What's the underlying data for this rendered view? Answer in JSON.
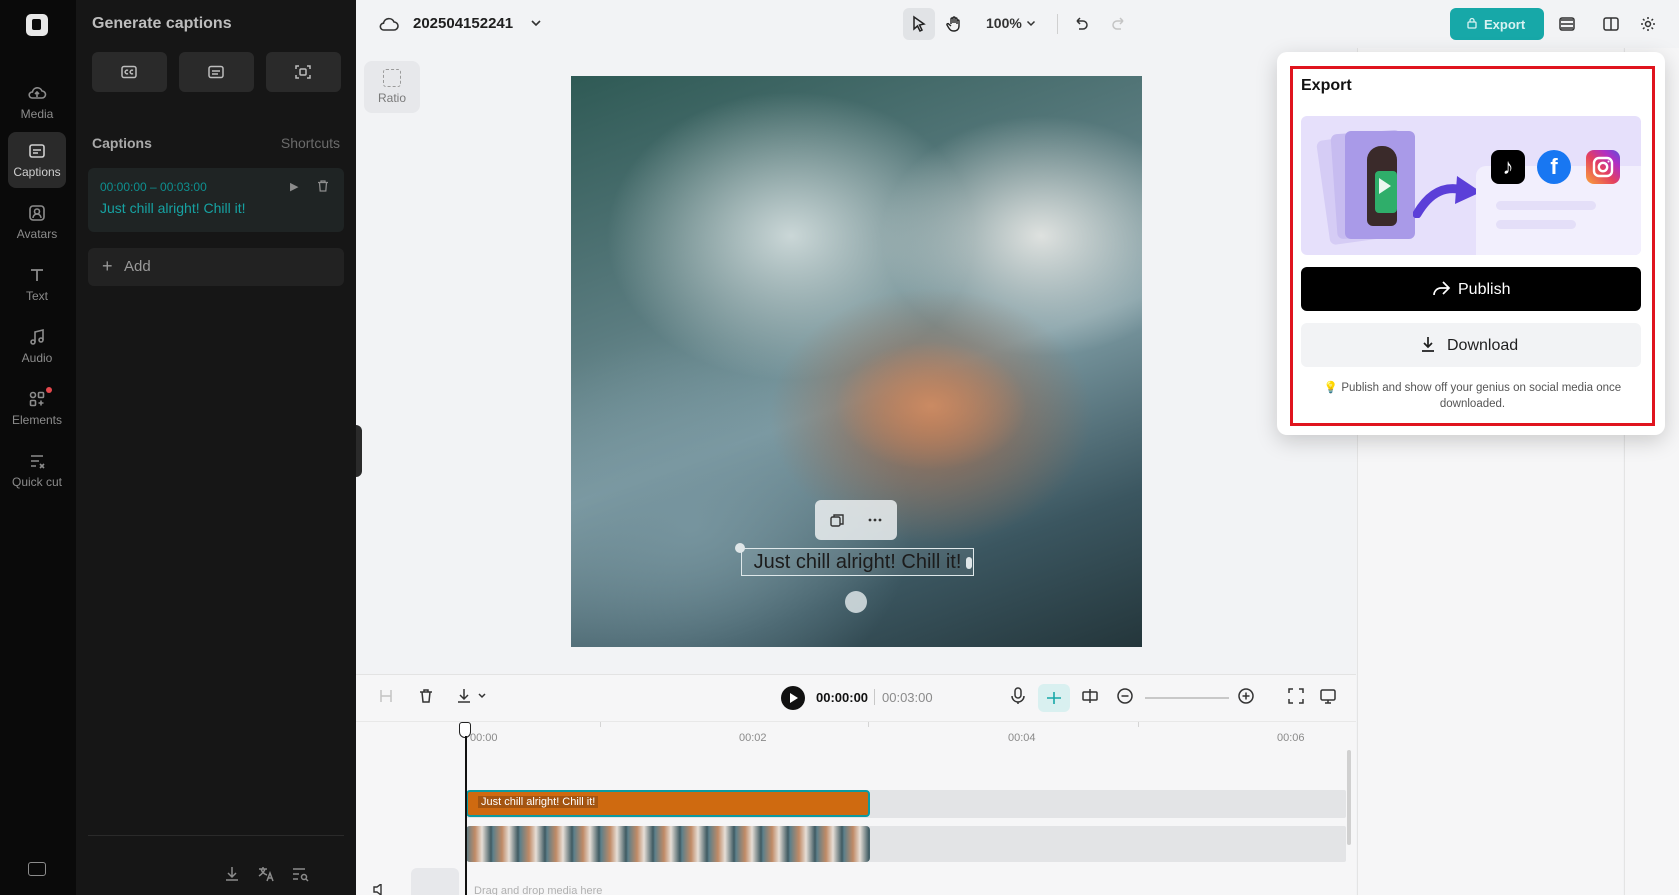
{
  "rail": {
    "items": [
      {
        "label": "Media",
        "icon": "cloud-upload-icon"
      },
      {
        "label": "Captions",
        "icon": "captions-icon",
        "active": true
      },
      {
        "label": "Avatars",
        "icon": "avatar-icon"
      },
      {
        "label": "Text",
        "icon": "text-icon"
      },
      {
        "label": "Audio",
        "icon": "music-note-icon"
      },
      {
        "label": "Elements",
        "icon": "elements-icon",
        "notification_dot": true
      },
      {
        "label": "Quick cut",
        "icon": "quick-cut-icon"
      }
    ]
  },
  "captions_panel": {
    "title": "Generate captions",
    "section_title": "Captions",
    "shortcuts_label": "Shortcuts",
    "caption": {
      "time": "00:00:00 – 00:03:00",
      "text": "Just chill alright! Chill it!"
    },
    "add_label": "Add"
  },
  "topbar": {
    "project_name": "202504152241",
    "zoom": "100%",
    "export_label": "Export"
  },
  "canvas": {
    "ratio_label": "Ratio",
    "caption_text": "Just chill alright! Chill it!"
  },
  "timeline": {
    "current_time": "00:00:00",
    "total_time": "00:03:00",
    "ticks": [
      "00:00",
      "00:02",
      "00:04",
      "00:06"
    ],
    "caption_clip_text": "Just chill alright! Chill it!",
    "drop_hint": "Drag and drop media here"
  },
  "export_popup": {
    "title": "Export",
    "publish_label": "Publish",
    "download_label": "Download",
    "hint": "Publish and show off your genius on social media once downloaded.",
    "accent_color": "#17a8a8",
    "highlight_color": "#e0141e"
  }
}
